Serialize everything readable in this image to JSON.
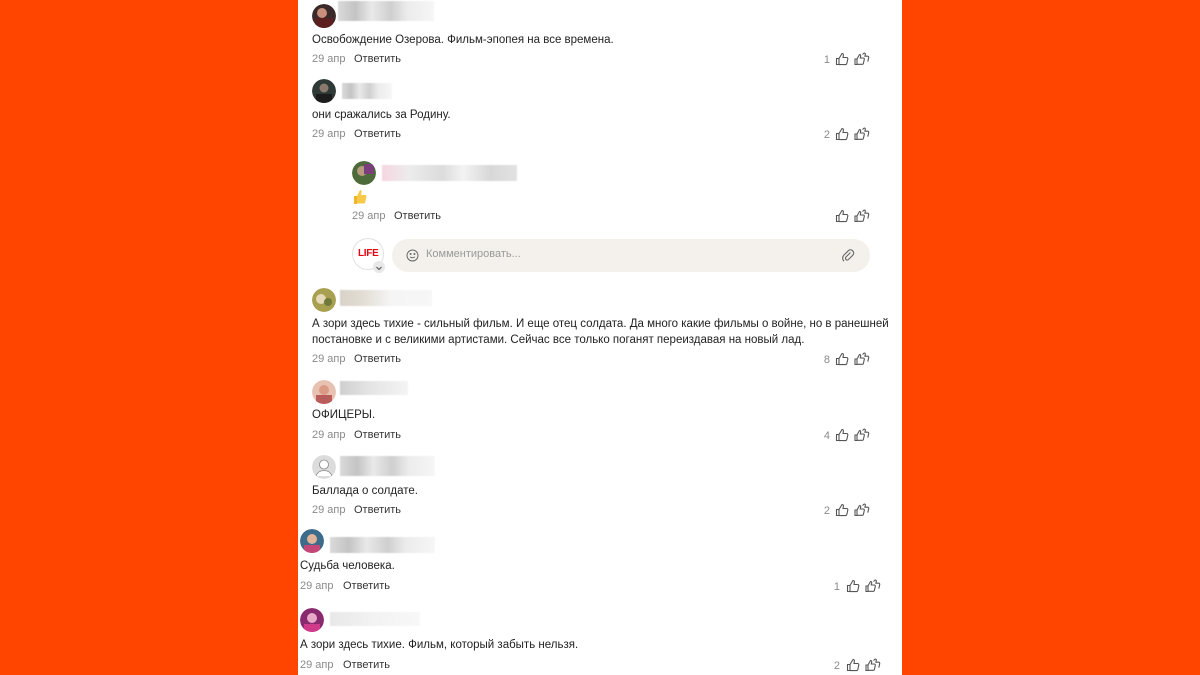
{
  "comments": [
    {
      "text": "Освобождение Озерова. Фильм-эпопея на все времена.",
      "date": "29 апр",
      "reply": "Ответить",
      "likes": "1"
    },
    {
      "text": "они сражались за Родину.",
      "date": "29 апр",
      "reply": "Ответить",
      "likes": "2"
    },
    {
      "text": "",
      "date": "29 апр",
      "reply": "Ответить",
      "likes": ""
    },
    {
      "text": "А зори здесь тихие - сильный фильм. И еще отец солдата. Да много какие фильмы о войне, но в ранешней",
      "text2": "постановке и с великими артистами. Сейчас все только поганят переиздавая на новый лад.",
      "date": "29 апр",
      "reply": "Ответить",
      "likes": "8"
    },
    {
      "text": "ОФИЦЕРЫ.",
      "date": "29 апр",
      "reply": "Ответить",
      "likes": "4"
    },
    {
      "text": "Баллада о солдате.",
      "date": "29 апр",
      "reply": "Ответить",
      "likes": "2"
    },
    {
      "text": "Судьба человека.",
      "date": "29 апр",
      "reply": "Ответить",
      "likes": "1"
    },
    {
      "text": "А зори здесь тихие. Фильм, который забыть нельзя.",
      "date": "29 апр",
      "reply": "Ответить",
      "likes": "2"
    }
  ],
  "reply_box": {
    "logo": "LIFE",
    "placeholder": "Комментировать..."
  },
  "colors": {
    "background": "#ff4500",
    "panel": "#ffffff",
    "logo_red": "#e30613",
    "input_bg": "#f4f1ec"
  },
  "icons": {
    "like": "thumb-up-icon",
    "super_like": "double-thumb-icon",
    "emoji": "smile-icon",
    "attach": "paperclip-icon",
    "thumbs_emoji": "thumbs-up-emoji"
  }
}
